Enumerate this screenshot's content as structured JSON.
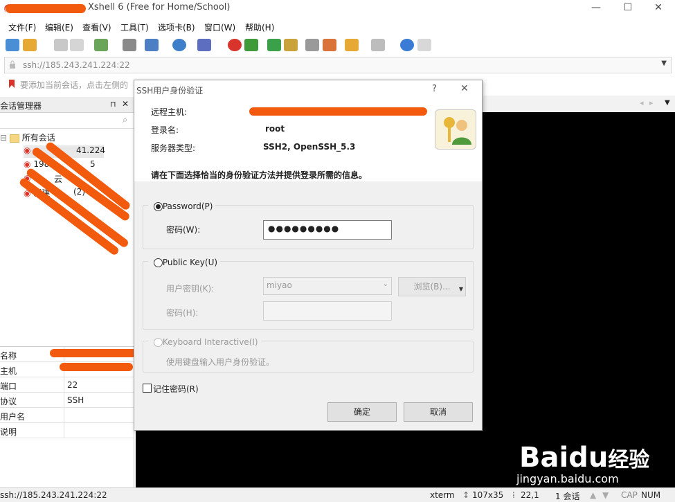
{
  "window": {
    "title": "Xshell 6 (Free for Home/School)"
  },
  "menu": [
    "文件(F)",
    "编辑(E)",
    "查看(V)",
    "工具(T)",
    "选项卡(B)",
    "窗口(W)",
    "帮助(H)"
  ],
  "address_bar": {
    "value": "ssh://185.243.241.224:22"
  },
  "info_bar": {
    "text": "要添加当前会话，点击左侧的"
  },
  "session_manager": {
    "title": "会话管理器",
    "pin": "ᵖ",
    "close": "✕",
    "tree": {
      "root": "所有会话",
      "items": [
        "41.224",
        "198.",
        "5",
        "云",
        "新建",
        "(2)"
      ]
    },
    "properties": [
      {
        "key": "名称",
        "value": ""
      },
      {
        "key": "主机",
        "value": ""
      },
      {
        "key": "端口",
        "value": "22"
      },
      {
        "key": "协议",
        "value": "SSH"
      },
      {
        "key": "用户名",
        "value": ""
      },
      {
        "key": "说明",
        "value": ""
      }
    ]
  },
  "dialog": {
    "title": "SSH用户身份验证",
    "help": "?",
    "close": "✕",
    "remote_host_label": "远程主机:",
    "login_label": "登录名:",
    "login_value": "root",
    "server_type_label": "服务器类型:",
    "server_type_value": "SSH2, OpenSSH_5.3",
    "instruction": "请在下面选择恰当的身份验证方法并提供登录所需的信息。",
    "password_method": "Password(P)",
    "password_label": "密码(W):",
    "password_value": "●●●●●●●●●",
    "publickey_method": "Public Key(U)",
    "user_key_label": "用户密钥(K):",
    "user_key_value": "miyao",
    "browse_label": "浏览(B)...",
    "passphrase_label": "密码(H):",
    "keyboard_method": "Keyboard Interactive(I)",
    "keyboard_desc": "使用键盘输入用户身份验证。",
    "remember_label": "记住密码(R)",
    "ok_label": "确定",
    "cancel_label": "取消"
  },
  "status_bar": {
    "address": "ssh://185.243.241.224:22",
    "term": "xterm",
    "size": "107x35",
    "pos": "22,1",
    "sessions": "1 会话",
    "cap": "CAP",
    "num": "NUM"
  },
  "watermark": {
    "brand": "Baidu",
    "brand_cn": "经验",
    "url": "jingyan.baidu.com"
  },
  "colors": {
    "accent": "#f25a0e",
    "terminal": "#000000"
  }
}
